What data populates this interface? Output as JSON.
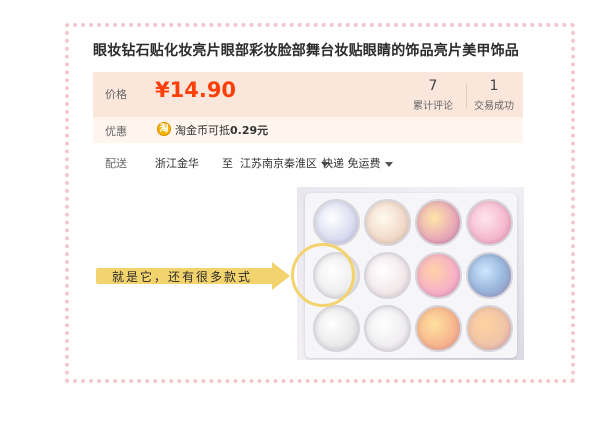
{
  "title": "眼妆钻石贴化妆亮片眼部彩妆脸部舞台妆贴眼睛的饰品亮片美甲饰品",
  "price": {
    "label": "价格",
    "value": "¥14.90"
  },
  "stats": {
    "reviews_count": "7",
    "reviews_label": "累计评论",
    "sales_count": "1",
    "sales_label": "交易成功"
  },
  "promo": {
    "label": "优惠",
    "icon": "coin-icon",
    "icon_glyph": "淘",
    "text_prefix": "淘金币可抵",
    "text_amount": "0.29元"
  },
  "shipping": {
    "label": "配送",
    "origin": "浙江金华",
    "to_word": "至",
    "destination": "江苏南京秦淮区",
    "method": "快递 免运费"
  },
  "annotation": {
    "arrow_text": "就是它，还有很多款式"
  },
  "colors": {
    "price": "#ff3f0a",
    "price_band": "#fbe6dc",
    "frame_dots": "#f2c6cc",
    "arrow": "#f3d36d"
  }
}
